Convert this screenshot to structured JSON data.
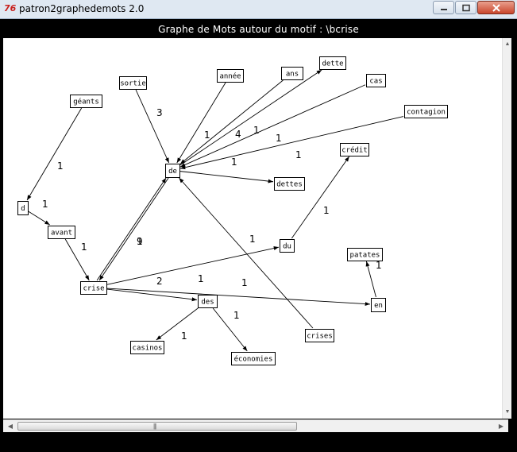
{
  "window": {
    "title": "patron2graphedemots 2.0",
    "icon": "app-logo-icon"
  },
  "diagram": {
    "title": "Graphe de Mots autour du motif : \\bcrise"
  },
  "nodes": [
    {
      "id": "sortie",
      "label": "sortie"
    },
    {
      "id": "annee",
      "label": "année"
    },
    {
      "id": "ans",
      "label": "ans"
    },
    {
      "id": "dette",
      "label": "dette"
    },
    {
      "id": "cas",
      "label": "cas"
    },
    {
      "id": "contagion",
      "label": "contagion"
    },
    {
      "id": "geants",
      "label": "géants"
    },
    {
      "id": "credit",
      "label": "crédit"
    },
    {
      "id": "de",
      "label": "de"
    },
    {
      "id": "dettes",
      "label": "dettes"
    },
    {
      "id": "d",
      "label": "d"
    },
    {
      "id": "avant",
      "label": "avant"
    },
    {
      "id": "du",
      "label": "du"
    },
    {
      "id": "patates",
      "label": "patates"
    },
    {
      "id": "crise",
      "label": "crise"
    },
    {
      "id": "des",
      "label": "des"
    },
    {
      "id": "en",
      "label": "en"
    },
    {
      "id": "crises",
      "label": "crises"
    },
    {
      "id": "casinos",
      "label": "casinos"
    },
    {
      "id": "economies",
      "label": "économies"
    }
  ],
  "edges": [
    {
      "from": "sortie",
      "to": "de",
      "label": "3"
    },
    {
      "from": "annee",
      "to": "de",
      "label": "1"
    },
    {
      "from": "ans",
      "to": "de",
      "label": "4"
    },
    {
      "from": "de",
      "to": "dette",
      "label": "1"
    },
    {
      "from": "cas",
      "to": "de",
      "label": "1"
    },
    {
      "from": "contagion",
      "to": "de",
      "label": "1"
    },
    {
      "from": "de",
      "to": "dettes",
      "label": "1"
    },
    {
      "from": "geants",
      "to": "d",
      "label": "1"
    },
    {
      "from": "d",
      "to": "avant",
      "label": "1"
    },
    {
      "from": "avant",
      "to": "crise",
      "label": "1"
    },
    {
      "from": "crise",
      "to": "de",
      "label": "9"
    },
    {
      "from": "de",
      "to": "crise",
      "label": "1"
    },
    {
      "from": "crise",
      "to": "du",
      "label": "1"
    },
    {
      "from": "du",
      "to": "credit",
      "label": "1"
    },
    {
      "from": "crise",
      "to": "des",
      "label": "2"
    },
    {
      "from": "crise",
      "to": "en",
      "label": "1"
    },
    {
      "from": "en",
      "to": "patates",
      "label": "1"
    },
    {
      "from": "crises",
      "to": "de",
      "label": "1"
    },
    {
      "from": "des",
      "to": "casinos",
      "label": "1"
    },
    {
      "from": "des",
      "to": "economies",
      "label": "1"
    }
  ],
  "scrollbars": {
    "vertical_up": "scroll-up-arrow-icon",
    "vertical_down": "scroll-down-arrow-icon",
    "horizontal_left": "scroll-left-arrow-icon",
    "horizontal_right": "scroll-right-arrow-icon",
    "grip_icon": "grip-icon"
  }
}
